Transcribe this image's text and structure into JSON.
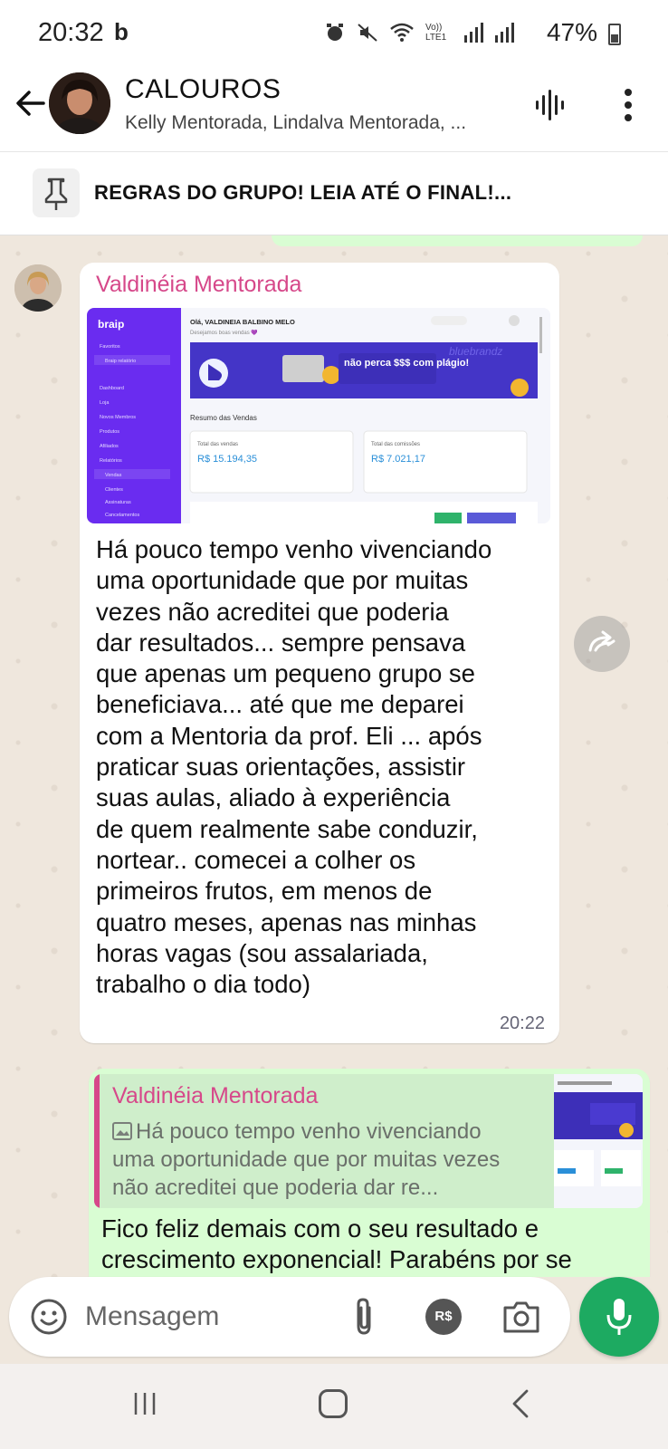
{
  "status_bar": {
    "time": "20:32",
    "carrier_icon": "b",
    "network_label": "Vo)) LTE1",
    "battery": "47%"
  },
  "header": {
    "title": "CALOUROS",
    "members": "Kelly Mentorada, Lindalva Mentorada, ..."
  },
  "pinned": {
    "text": "REGRAS DO GRUPO! LEIA ATÉ O FINAL!..."
  },
  "messages": [
    {
      "sender": "Valdinéia Mentorada",
      "sender_color": "#d6488a",
      "image": {
        "brand": "braip",
        "greeting": "Olá, VALDINEIA BALBINO MELO",
        "subgreeting": "Desejamos boas vendas 💜",
        "banner_text": "não perca $$$ com plágio!",
        "banner_watermark": "bluebrandz",
        "section_title": "Resumo das Vendas",
        "total_vendas_label": "Total das vendas",
        "total_vendas_value": "R$ 15.194,35",
        "total_comissoes_label": "Total das comissões",
        "total_comissoes_value": "R$ 7.021,17",
        "sidebar_items": [
          "Favoritos",
          "Braip relatório",
          "Dashboard",
          "Loja",
          "Novos Membros",
          "Produtos",
          "Afiliados",
          "Relatórios",
          "Vendas",
          "Clientes",
          "Assinaturas",
          "Cancelamentos"
        ]
      },
      "text": "Há pouco tempo venho vivenciando\numa oportunidade que por muitas\nvezes não acreditei que poderia\ndar resultados... sempre pensava\nque apenas um pequeno grupo se\nbeneficiava... até que me deparei\ncom a Mentoria da prof. Eli ... após\npraticar suas orientações, assistir\nsuas aulas, aliado à experiência\nde quem realmente sabe conduzir,\nnortear..  comecei a colher os\nprimeiros frutos, em menos de\nquatro meses, apenas nas minhas\nhoras vagas (sou assalariada,\ntrabalho o dia todo)",
      "time": "20:22"
    },
    {
      "quote_sender": "Valdinéia Mentorada",
      "quote_text": "Há pouco tempo venho vivenciando uma oportunidade que por muitas vezes não acreditei que poderia dar re...",
      "text": "Fico feliz demais com o seu resultado e crescimento exponencial! Parabéns por se"
    }
  ],
  "input": {
    "placeholder": "Mensagem",
    "payment_label": "R$"
  },
  "colors": {
    "chat_bg": "#efe7dd",
    "outgoing_bubble": "#d9fdd3",
    "mic_button": "#1daa61",
    "sender_name": "#d6488a"
  },
  "icons": [
    "back-arrow-icon",
    "voice-chat-icon",
    "more-vert-icon",
    "pin-icon",
    "forward-icon",
    "emoji-icon",
    "attach-icon",
    "payment-icon",
    "camera-icon",
    "mic-icon",
    "nav-recent-icon",
    "nav-home-icon",
    "nav-back-icon"
  ]
}
